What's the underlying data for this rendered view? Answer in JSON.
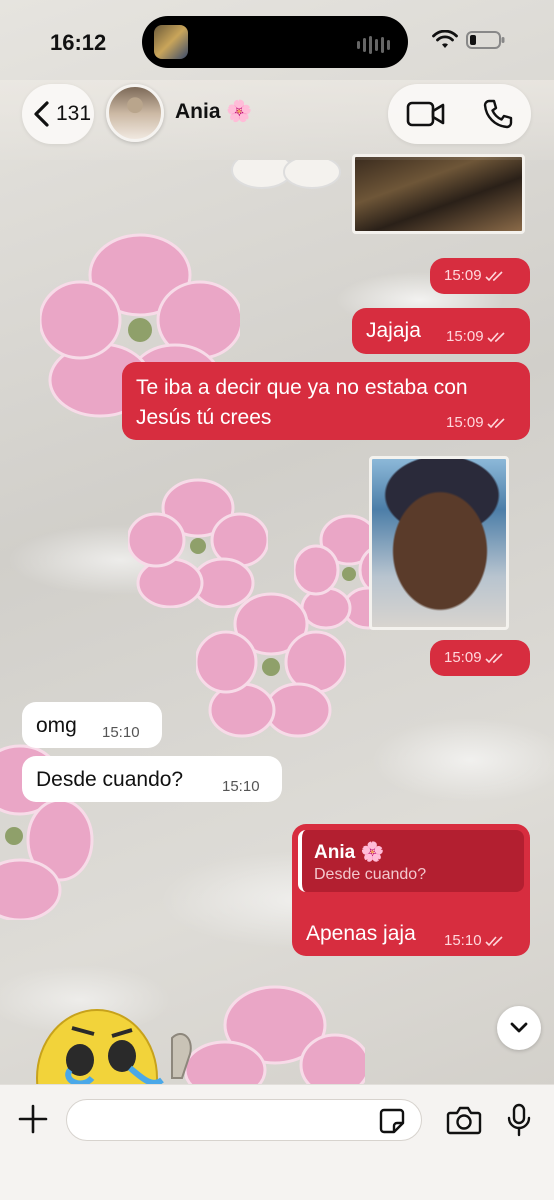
{
  "status_bar": {
    "time": "16:12"
  },
  "header": {
    "back_count": "131",
    "contact_name": "Ania 🌸"
  },
  "messages": [
    {
      "id": "m1",
      "direction": "outgoing",
      "type": "image",
      "time": ""
    },
    {
      "id": "m2",
      "direction": "outgoing",
      "type": "sticker-meta",
      "time": "15:09",
      "status": "read"
    },
    {
      "id": "m3",
      "direction": "outgoing",
      "type": "text",
      "text": "Jajaja",
      "time": "15:09",
      "status": "read"
    },
    {
      "id": "m4",
      "direction": "outgoing",
      "type": "text",
      "text_line1": "Te iba a decir que ya no estaba con",
      "text_line2": "Jesús tú crees",
      "time": "15:09",
      "status": "read"
    },
    {
      "id": "m5",
      "direction": "outgoing",
      "type": "image",
      "time": ""
    },
    {
      "id": "m6",
      "direction": "outgoing",
      "type": "sticker-meta",
      "time": "15:09",
      "status": "read"
    },
    {
      "id": "m7",
      "direction": "incoming",
      "type": "text",
      "text": "omg",
      "time": "15:10"
    },
    {
      "id": "m8",
      "direction": "incoming",
      "type": "text",
      "text": "Desde cuando?",
      "time": "15:10"
    },
    {
      "id": "m9",
      "direction": "outgoing",
      "type": "reply",
      "quote_author": "Ania 🌸",
      "quote_text": "Desde cuando?",
      "text": "Apenas jaja",
      "time": "15:10",
      "status": "read"
    }
  ],
  "composer": {
    "value": "",
    "placeholder": ""
  },
  "colors": {
    "outgoing_bubble": "#d72d3f",
    "incoming_bubble": "#ffffff",
    "header_bg": "#f0ece6"
  },
  "icons": [
    "back-chevron-icon",
    "video-call-icon",
    "phone-icon",
    "plus-icon",
    "sticker-icon",
    "camera-icon",
    "microphone-icon",
    "chevron-down-icon",
    "wifi-icon",
    "battery-icon",
    "double-check-icon"
  ]
}
